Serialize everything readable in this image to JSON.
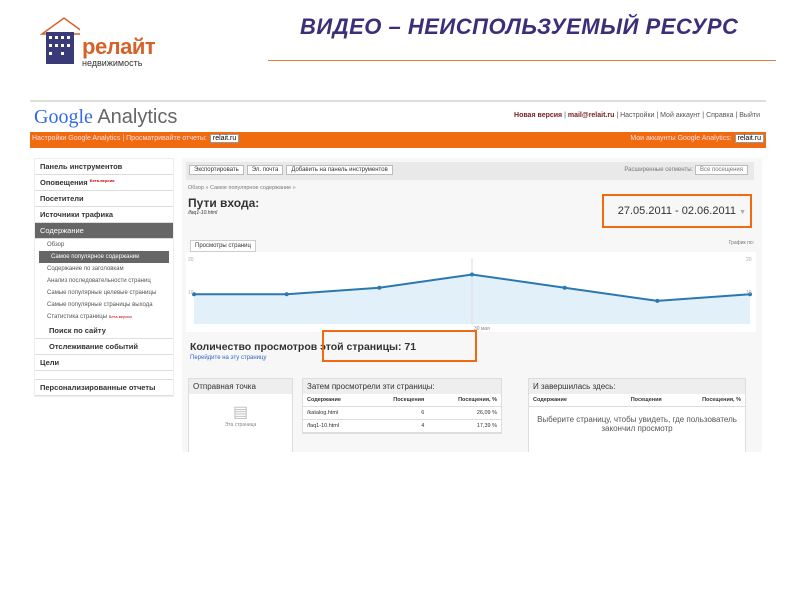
{
  "slide": {
    "title": "ВИДЕО – НЕИСПОЛЬЗУЕМЫЙ РЕСУРС",
    "logo_name": "релайт",
    "logo_sub": "недвижимость"
  },
  "ga": {
    "logo_google": "Google",
    "logo_analytics": "Analytics",
    "top_links": {
      "new_version": "Новая версия",
      "email": "mail@relait.ru",
      "settings": "Настройки",
      "account": "Мой аккаунт",
      "help": "Справка",
      "logout": "Выйти"
    },
    "orange_bar": {
      "settings": "Настройки Google Analytics",
      "view_reports": "Просматривайте отчеты:",
      "site": "relait.ru",
      "my_accounts": "Мои аккаунты Google Analytics:",
      "account_site": "relait.ru"
    },
    "sidebar": {
      "items": [
        {
          "label": "Панель инструментов",
          "icon": "dashboard-icon"
        },
        {
          "label": "Оповещения",
          "beta": "Бета-версия",
          "icon": "alert-icon"
        },
        {
          "label": "Посетители",
          "icon": "person-icon"
        },
        {
          "label": "Источники трафика",
          "icon": "traffic-icon"
        },
        {
          "label": "Содержание",
          "icon": "content-icon",
          "active": true
        }
      ],
      "sub_items": [
        {
          "label": "Обзор"
        },
        {
          "label": "Самое популярное содержание",
          "active": true
        },
        {
          "label": "Содержание по заголовкам"
        },
        {
          "label": "Анализ последовательности страниц"
        },
        {
          "label": "Самые популярные целевые страницы"
        },
        {
          "label": "Самые популярные страницы выхода"
        },
        {
          "label": "Статистика страницы",
          "beta": "Бета-версия"
        }
      ],
      "after_items": [
        {
          "label": "Поиск по сайту"
        },
        {
          "label": "Отслеживание событий"
        },
        {
          "label": "Цели"
        }
      ],
      "custom_reports": "Персонализированные отчеты"
    },
    "toolbar": {
      "export": "Экспортировать",
      "email": "Эл. почта",
      "add_dashboard": "Добавить на панель инструментов",
      "segments_label": "Расширенные сегменты:",
      "segment": "Все посещения"
    },
    "breadcrumb": "Обзор » Самое популярное содержание »",
    "page_title": "Пути входа:",
    "page_subtitle": "/faq1-10.html",
    "date_range": "27.05.2011 - 02.06.2011",
    "chart_tab": "Просмотры страниц",
    "graph_by": "График по:",
    "count_label": "Количество просмотров этой страницы: 71",
    "goto_link": "Перейдите на эту страницу",
    "start": {
      "title": "Отправная точка",
      "caption": "Эта страница"
    },
    "next": {
      "title": "Затем просмотрели эти страницы:",
      "headers": [
        "Содержание",
        "Посещения",
        "Посещения, %"
      ],
      "rows": [
        [
          "/katalog.html",
          "6",
          "26,09 %"
        ],
        [
          "/faq1-10.html",
          "4",
          "17,39 %"
        ]
      ]
    },
    "end": {
      "title": "И завершилась здесь:",
      "headers": [
        "Содержание",
        "Посещения",
        "Посещения, %"
      ],
      "message": "Выберите страницу, чтобы увидеть, где пользователь закончил просмотр"
    }
  },
  "chart_data": {
    "type": "area",
    "ylim": [
      0,
      20
    ],
    "yticks": [
      "10",
      "20"
    ],
    "x_label": "30 мая",
    "values": [
      9,
      9,
      11,
      15,
      11,
      7,
      9
    ],
    "color": "#2a78b0",
    "fill": "#e2f0f9"
  },
  "colors": {
    "accent": "#f06a0f",
    "title": "#3a2f78"
  }
}
